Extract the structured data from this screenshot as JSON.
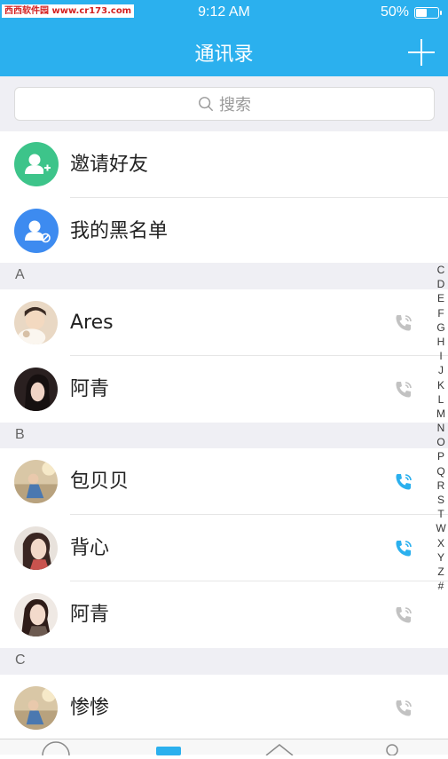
{
  "status_bar": {
    "watermark": "西西软件园 www.cr173.com",
    "time": "9:12 AM",
    "battery": "50%",
    "battery_level": 0.5
  },
  "header": {
    "title": "通讯录",
    "add_icon": "plus-icon"
  },
  "search": {
    "placeholder": "搜索",
    "icon": "search-icon"
  },
  "actions": [
    {
      "label": "邀请好友",
      "icon": "invite-user-icon",
      "color": "#3dc48a"
    },
    {
      "label": "我的黑名单",
      "icon": "blocked-user-icon",
      "color": "#3d8bf0"
    }
  ],
  "sections": [
    {
      "letter": "A",
      "contacts": [
        {
          "name": "Ares",
          "phone_active": false
        },
        {
          "name": "阿青",
          "phone_active": false
        }
      ]
    },
    {
      "letter": "B",
      "contacts": [
        {
          "name": "包贝贝",
          "phone_active": true
        },
        {
          "name": "背心",
          "phone_active": true
        },
        {
          "name": "阿青",
          "phone_active": false
        }
      ]
    },
    {
      "letter": "C",
      "contacts": [
        {
          "name": "惨惨",
          "phone_active": false
        }
      ]
    }
  ],
  "index_letters": [
    "C",
    "D",
    "E",
    "F",
    "G",
    "H",
    "I",
    "J",
    "K",
    "L",
    "M",
    "N",
    "O",
    "P",
    "Q",
    "R",
    "S",
    "T",
    "W",
    "X",
    "Y",
    "Z",
    "#"
  ],
  "colors": {
    "accent": "#2bb0ee",
    "phone_active": "#2bb0ee",
    "phone_inactive": "#c2c2c2"
  }
}
